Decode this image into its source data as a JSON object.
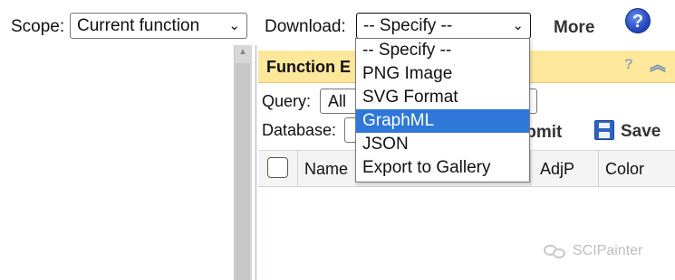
{
  "toolbar": {
    "scope_label": "Scope:",
    "scope_value": "Current function",
    "download_label": "Download:",
    "download_value": "-- Specify --",
    "more_label": "More",
    "help_glyph": "?"
  },
  "download_menu": {
    "options": [
      "-- Specify --",
      "PNG Image",
      "SVG Format",
      "GraphML",
      "JSON",
      "Export to Gallery"
    ],
    "highlighted": "GraphML"
  },
  "panel": {
    "title": "Function E",
    "help_glyph": "?",
    "collapse_glyph": "︽",
    "query_label": "Query:",
    "query_value": "All",
    "database_label": "Database:",
    "submit_label": "ıbmit",
    "save_label": "Save",
    "columns": [
      "Name",
      "AdjP",
      "Color"
    ]
  },
  "watermark": {
    "text": "SCIPainter",
    "icon": "wechat-icon"
  },
  "colors": {
    "panel_header_bg": "#fde79b",
    "menu_highlight": "#2f77d8",
    "help_button": "#2a4fc6"
  }
}
